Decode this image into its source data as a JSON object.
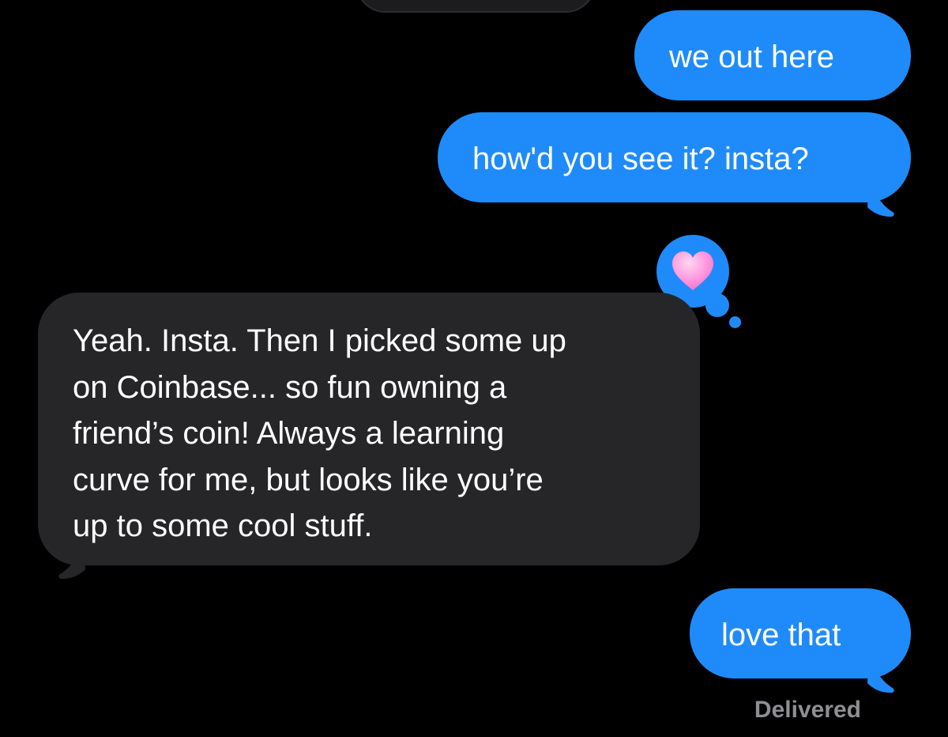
{
  "conversation": {
    "messages": [
      {
        "direction": "sent",
        "text": "we out here"
      },
      {
        "direction": "sent",
        "text": "how'd you see it? insta?"
      },
      {
        "direction": "received",
        "text": "Yeah. Insta. Then I picked some up\non Coinbase... so fun owning a\nfriend’s coin! Always a learning\ncurve for me, but looks like you’re\nup to some cool stuff."
      },
      {
        "direction": "sent",
        "text": "love that"
      }
    ],
    "status": "Delivered",
    "tapback": {
      "icon": "heart-icon",
      "color": "#ff8fd8"
    }
  },
  "colors": {
    "background": "#000000",
    "sent_bubble": "#1f8bfa",
    "received_bubble": "#262629",
    "status_text": "#8e8e93"
  }
}
